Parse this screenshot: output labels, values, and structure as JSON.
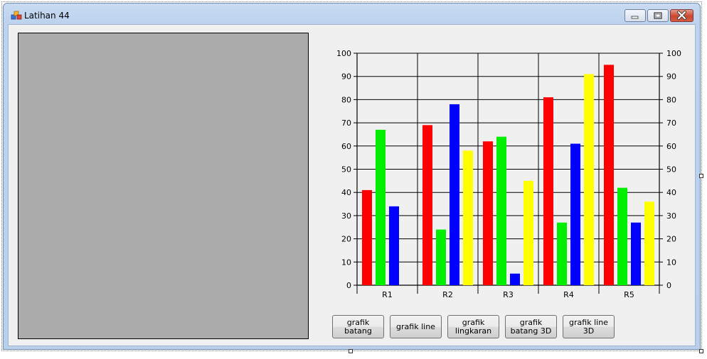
{
  "window": {
    "title": "Latihan 44"
  },
  "buttons": [
    {
      "id": "grafik-batang",
      "label": "grafik\nbatang"
    },
    {
      "id": "grafik-line",
      "label": "grafik line"
    },
    {
      "id": "grafik-lingkaran",
      "label": "grafik\nlingkaran"
    },
    {
      "id": "grafik-batang-3d",
      "label": "grafik\nbatang 3D"
    },
    {
      "id": "grafik-line-3d",
      "label": "grafik line\n3D"
    }
  ],
  "colors": {
    "series": [
      "#ff0000",
      "#00ee00",
      "#0000ff",
      "#ffff00"
    ]
  },
  "chart_data": {
    "type": "bar",
    "categories": [
      "R1",
      "R2",
      "R3",
      "R4",
      "R5"
    ],
    "series": [
      {
        "values": [
          41,
          69,
          62,
          81,
          95
        ]
      },
      {
        "values": [
          67,
          24,
          64,
          27,
          42
        ]
      },
      {
        "values": [
          34,
          78,
          5,
          61,
          27
        ]
      },
      {
        "values": [
          0,
          58,
          45,
          91,
          36
        ]
      }
    ],
    "ylim": [
      0,
      100
    ],
    "yticks": [
      0,
      10,
      20,
      30,
      40,
      50,
      60,
      70,
      80,
      90,
      100
    ],
    "secondary_y_axis": true,
    "grid": true,
    "legend": "none"
  }
}
